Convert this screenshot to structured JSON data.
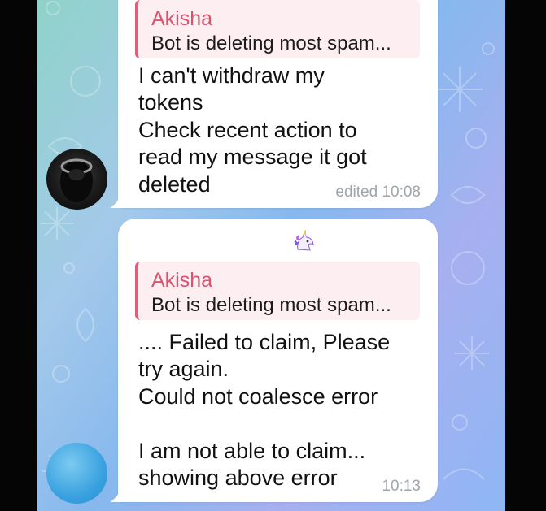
{
  "messages": [
    {
      "reply": {
        "name": "Akisha",
        "text": "Bot is deleting most spam..."
      },
      "lines": [
        "I can't withdraw my",
        "tokens",
        "Check recent action to",
        "read my message it got",
        "deleted"
      ],
      "meta": "edited 10:08"
    },
    {
      "reaction": "unicorn-icon",
      "reply": {
        "name": "Akisha",
        "text": "Bot is deleting most spam..."
      },
      "lines": [
        ".... Failed to claim, Please",
        "try again.",
        "Could not coalesce error",
        "",
        "I am not able to claim...",
        "showing above error"
      ],
      "meta": "10:13"
    }
  ],
  "colors": {
    "reply_accent": "#e0607b",
    "reply_bg": "#fdeef1",
    "bubble_bg": "#ffffff",
    "meta_text": "#9fa5ab"
  }
}
